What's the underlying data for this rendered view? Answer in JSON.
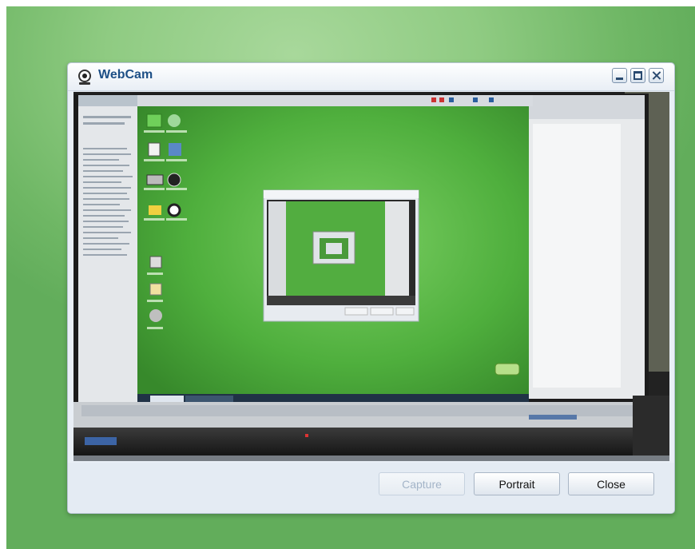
{
  "window": {
    "title": "WebCam"
  },
  "buttons": {
    "capture_label": "Capture",
    "portrait_label": "Portrait",
    "close_label": "Close"
  },
  "icons": {
    "window_icon": "webcam-icon",
    "minimize": "minimize-icon",
    "maximize": "maximize-icon",
    "close": "close-icon"
  },
  "colors": {
    "title_text": "#1d4f86",
    "desktop_green": "#8fcb82",
    "feed_green": "#4fae3e",
    "disabled_text": "#a3b4c8"
  }
}
